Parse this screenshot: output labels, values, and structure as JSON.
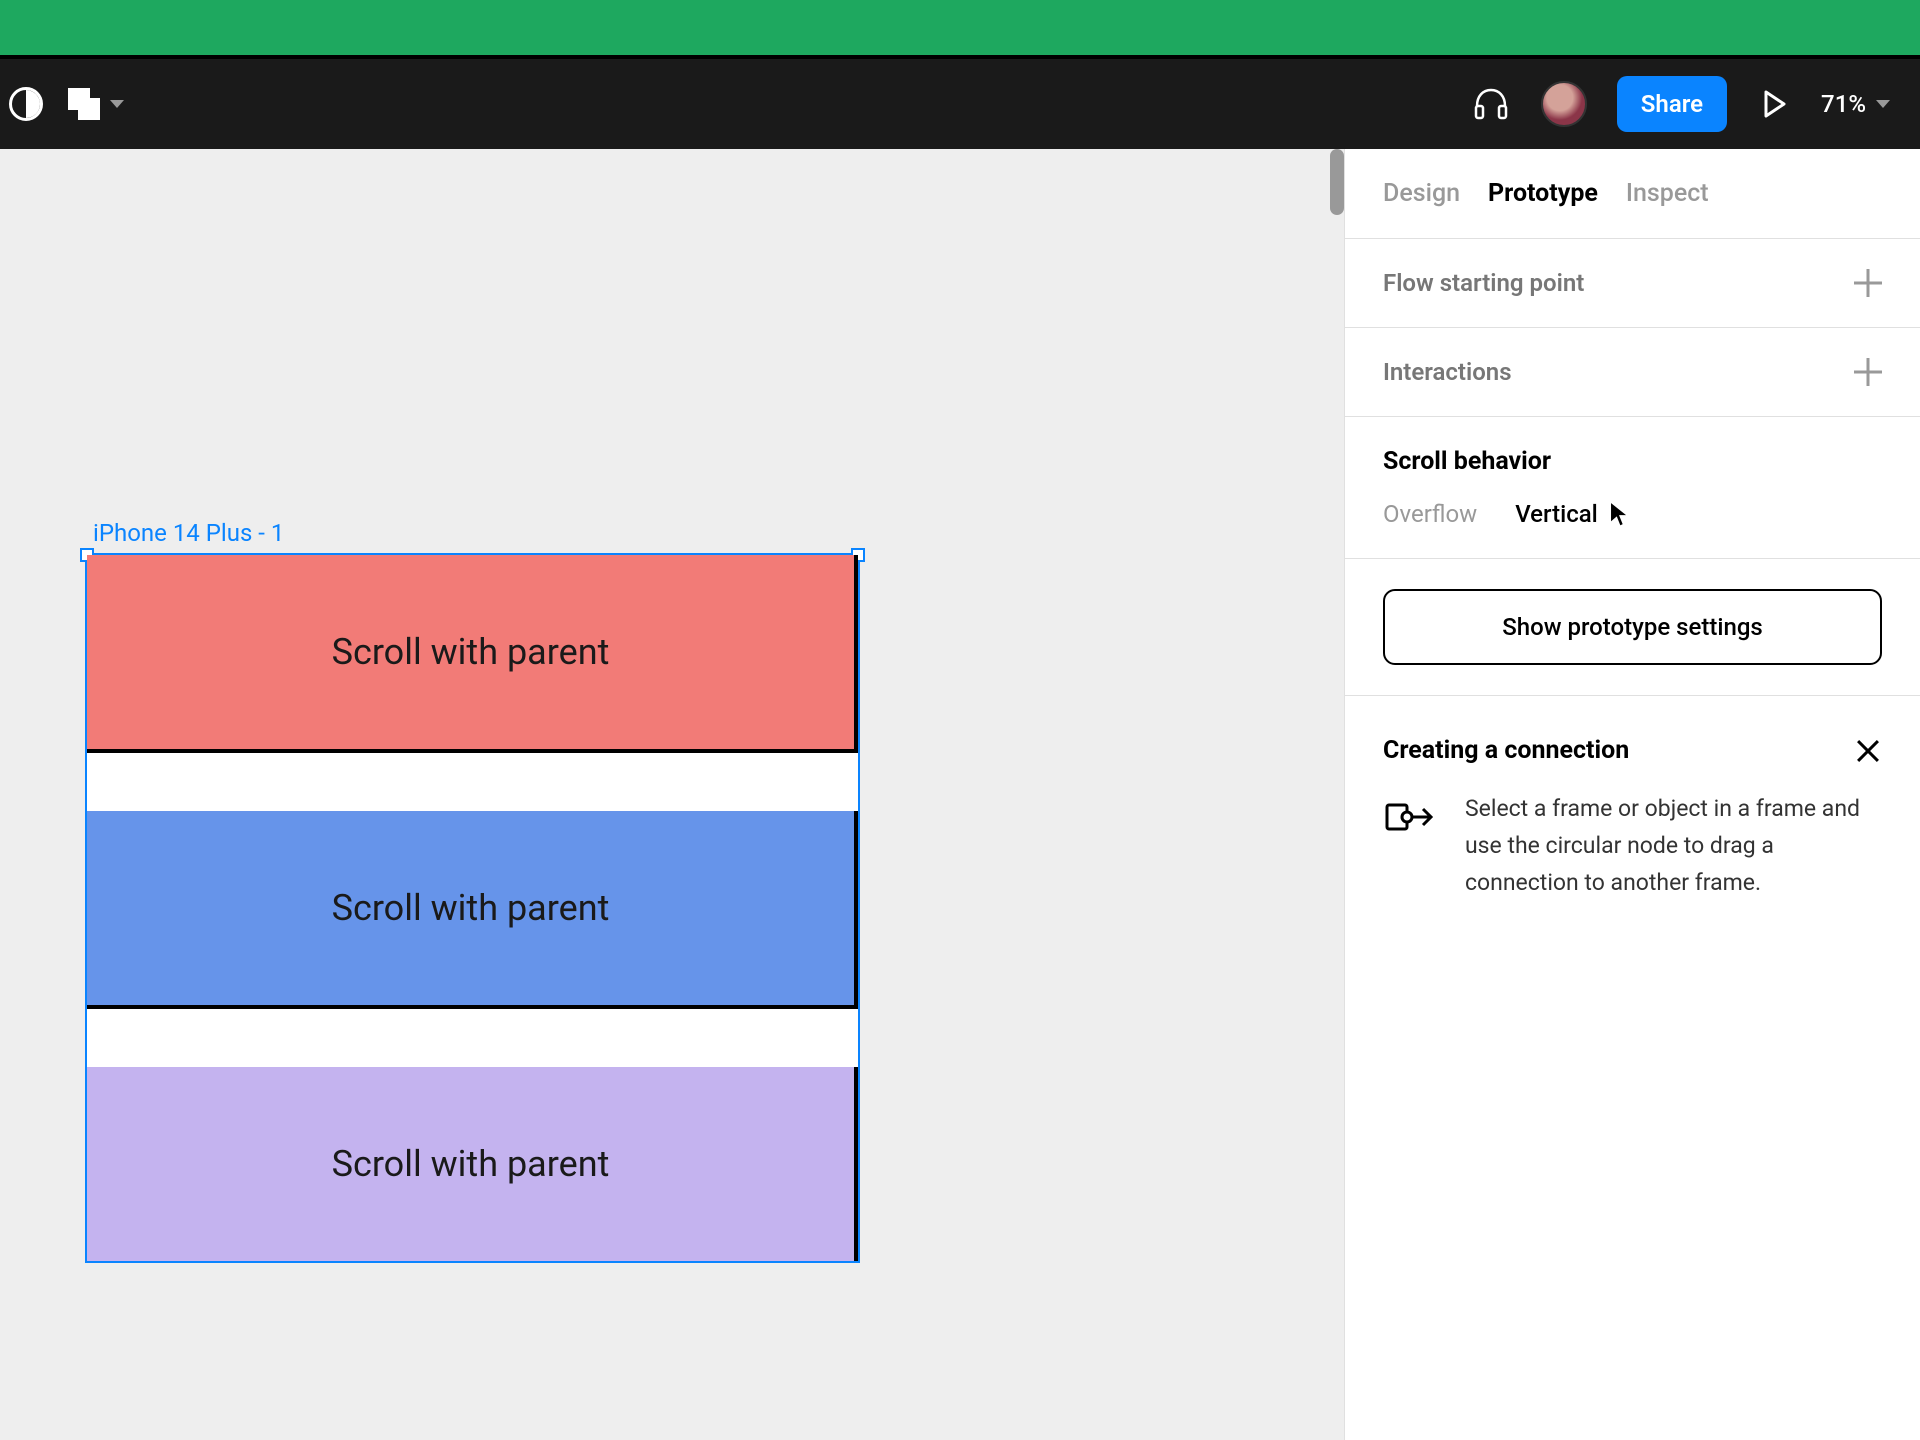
{
  "toolbar": {
    "share_label": "Share",
    "zoom_level": "71%"
  },
  "canvas": {
    "frame_label": "iPhone 14 Plus - 1",
    "cards": [
      {
        "text": "Scroll with parent"
      },
      {
        "text": "Scroll with parent"
      },
      {
        "text": "Scroll with parent"
      }
    ]
  },
  "panel": {
    "tabs": {
      "design": "Design",
      "prototype": "Prototype",
      "inspect": "Inspect"
    },
    "flow_label": "Flow starting point",
    "interactions_label": "Interactions",
    "scroll_behavior_title": "Scroll behavior",
    "overflow_label": "Overflow",
    "overflow_value": "Vertical",
    "settings_button": "Show prototype settings",
    "connection_title": "Creating a connection",
    "connection_text": "Select a frame or object in a frame and use the circular node to drag a connection to another frame."
  }
}
